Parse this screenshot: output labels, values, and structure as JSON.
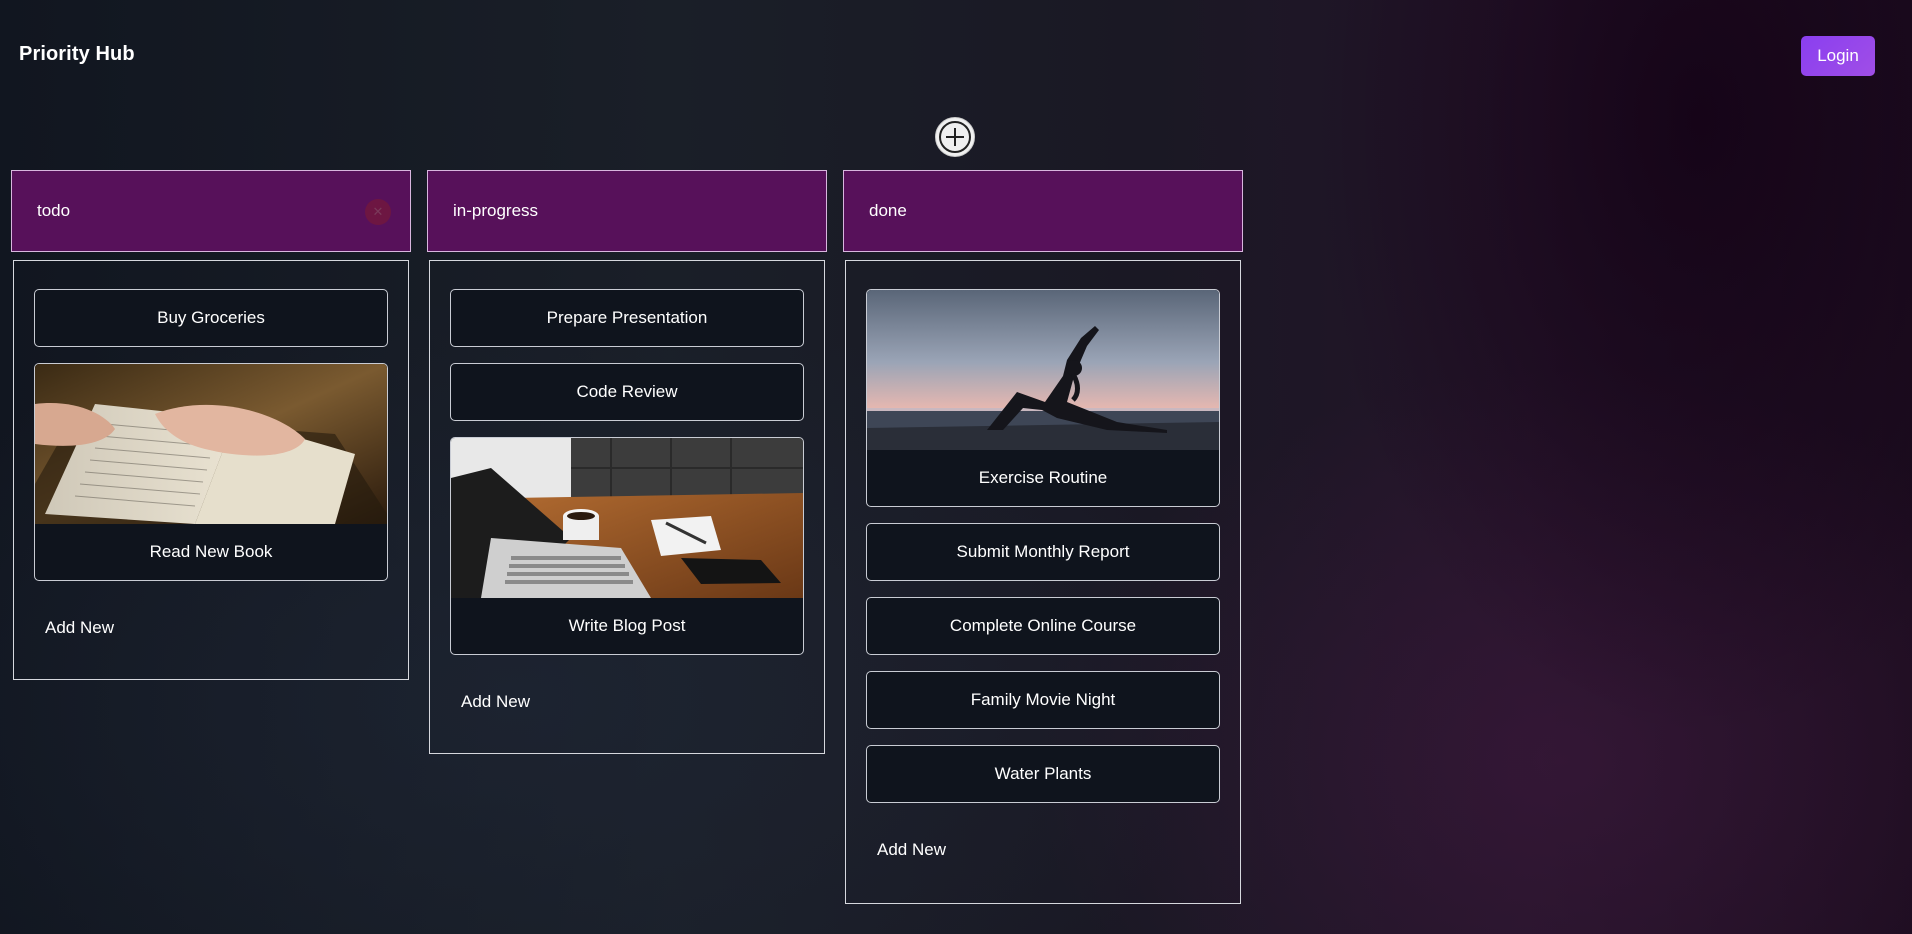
{
  "app": {
    "title": "Priority Hub",
    "login_label": "Login"
  },
  "columns": [
    {
      "title": "todo",
      "cards": [
        {
          "title": "Buy Groceries"
        },
        {
          "title": "Read New Book",
          "image": "book-photo"
        }
      ],
      "add_label": "Add New"
    },
    {
      "title": "in-progress",
      "cards": [
        {
          "title": "Prepare Presentation"
        },
        {
          "title": "Code Review"
        },
        {
          "title": "Write Blog Post",
          "image": "laptop-desk-photo"
        }
      ],
      "add_label": "Add New"
    },
    {
      "title": "done",
      "cards": [
        {
          "title": "Exercise Routine",
          "image": "yoga-sunset-photo"
        },
        {
          "title": "Submit Monthly Report"
        },
        {
          "title": "Complete Online Course"
        },
        {
          "title": "Family Movie Night"
        },
        {
          "title": "Water Plants"
        }
      ],
      "add_label": "Add New"
    }
  ],
  "colors": {
    "column_header": "#57115a",
    "login_button": "#8a3ff0"
  }
}
